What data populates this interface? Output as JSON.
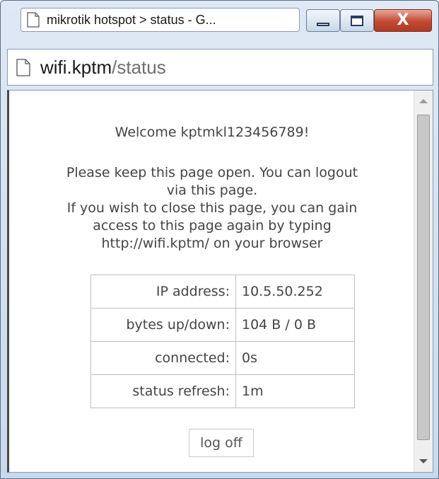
{
  "window": {
    "tab_title": "mikrotik hotspot > status - G...",
    "controls": {
      "minimize": "",
      "maximize": "",
      "close": "X"
    }
  },
  "address": {
    "host": "wifi.kptm",
    "path": "/status"
  },
  "page": {
    "welcome": "Welcome kptmkl123456789!",
    "message_lines": [
      "Please keep this page open. You can logout",
      "via this page.",
      "If you wish to close this page, you can gain",
      "access to this page again by typing",
      "http://wifi.kptm/ on your browser"
    ],
    "status_rows": [
      {
        "label": "IP address:",
        "value": "10.5.50.252"
      },
      {
        "label": "bytes up/down:",
        "value": "104 B / 0 B"
      },
      {
        "label": "connected:",
        "value": "0s"
      },
      {
        "label": "status refresh:",
        "value": "1m"
      }
    ],
    "logoff_label": "log off"
  },
  "icons": {
    "tab_icon": "page-icon",
    "address_icon": "page-icon",
    "scroll_up": "scroll-up-icon",
    "scroll_down": "scroll-down-icon"
  }
}
